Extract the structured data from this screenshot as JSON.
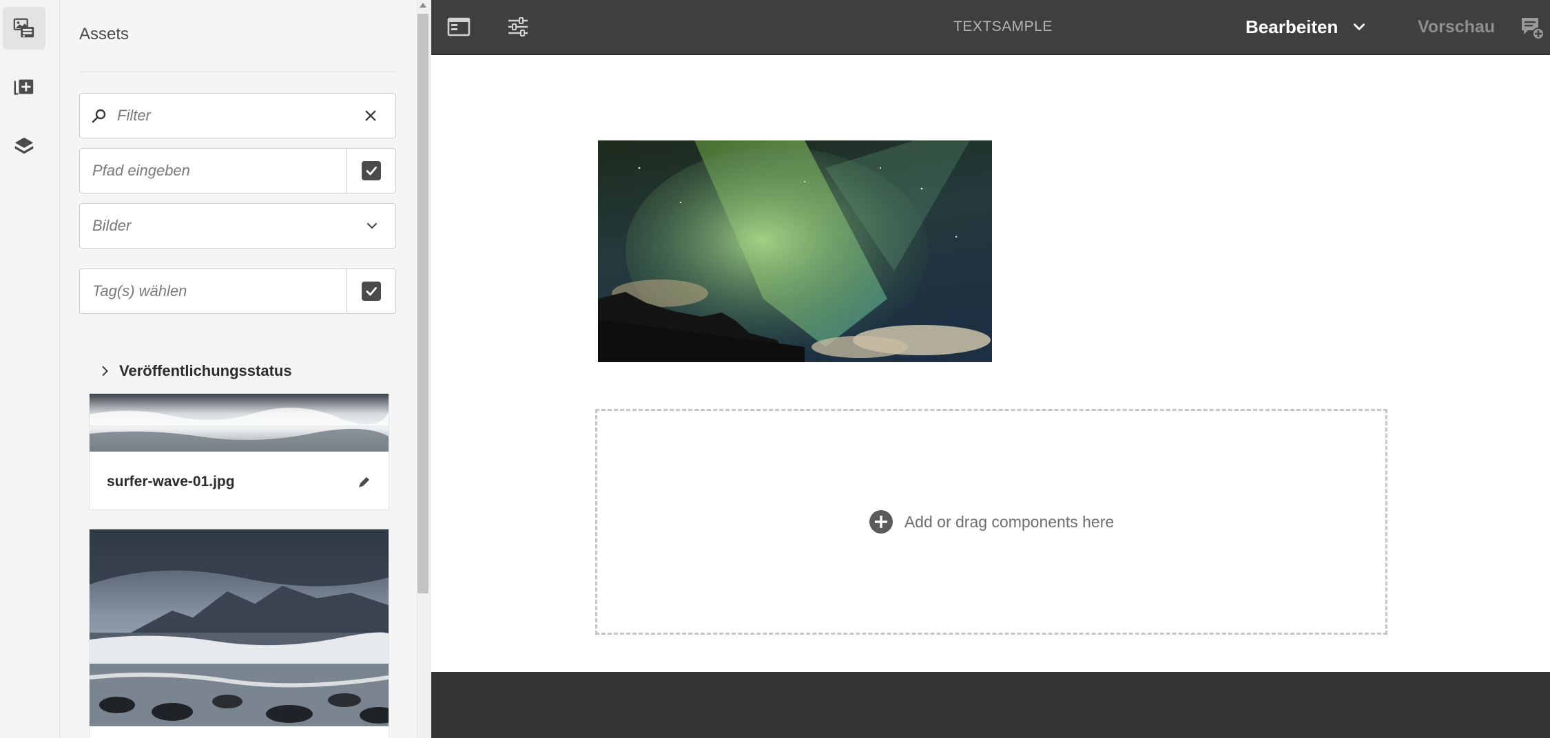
{
  "rail": {
    "items": [
      {
        "name": "assets-icon",
        "active": true
      },
      {
        "name": "components-icon",
        "active": false
      },
      {
        "name": "content-tree-icon",
        "active": false
      }
    ]
  },
  "panel": {
    "title": "Assets",
    "filter": {
      "placeholder": "Filter"
    },
    "path": {
      "placeholder": "Pfad eingeben"
    },
    "type_select": {
      "value": "Bilder"
    },
    "tags": {
      "placeholder": "Tag(s) wählen"
    },
    "publication_status": {
      "label": "Veröffentlichungsstatus"
    },
    "assets": [
      {
        "name": "surfer-wave-01.jpg"
      }
    ]
  },
  "topbar": {
    "page_title": "TEXTSAMPLE",
    "mode": "Bearbeiten",
    "preview": "Vorschau"
  },
  "canvas": {
    "dropzone_text": "Add or drag components here"
  },
  "colors": {
    "topbar_bg": "#3f3f3f",
    "footer_bg": "#333333",
    "panel_bg": "#f5f5f5",
    "dropzone_border": "#c6c6c6"
  }
}
